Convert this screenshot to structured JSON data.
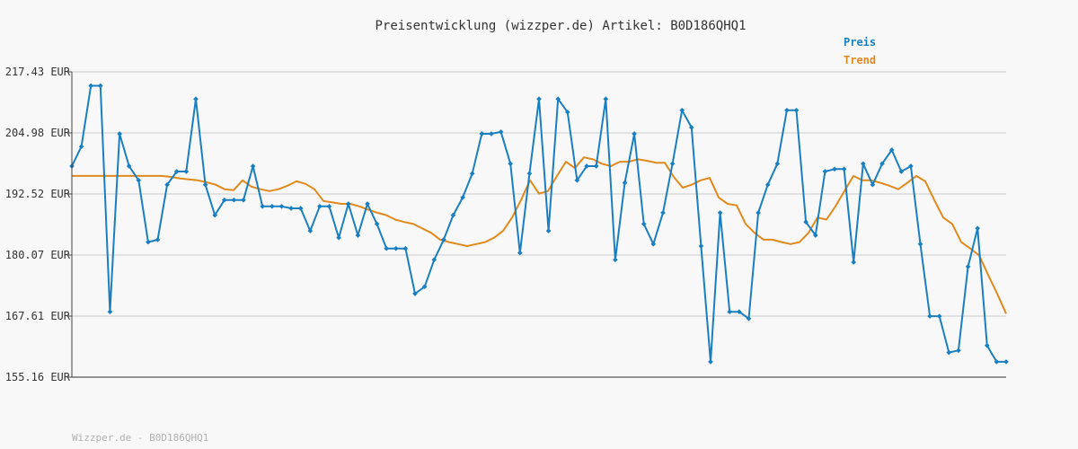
{
  "title": "Preisentwicklung (wizzper.de) Artikel: B0D186QHQ1",
  "footer": "Wizzper.de - B0D186QHQ1",
  "colors": {
    "background": "#f8f8f8",
    "grid": "#e2e2e2",
    "axis": "#444444",
    "preis": "#1a7fc0",
    "trend": "#e08a1e"
  },
  "chart_data": {
    "type": "line",
    "title": "Preisentwicklung (wizzper.de) Artikel: B0D186QHQ1",
    "xlabel": "",
    "ylabel": "",
    "ylim": [
      155.16,
      217.43
    ],
    "yticks": [
      "217.43 EUR",
      "204.98 EUR",
      "192.52 EUR",
      "180.07 EUR",
      "167.61 EUR",
      "155.16 EUR"
    ],
    "ytick_values": [
      217.43,
      204.98,
      192.52,
      180.07,
      167.61,
      155.16
    ],
    "grid": true,
    "legend_position": "top-right",
    "series": [
      {
        "name": "Preis",
        "color": "#1a7fc0",
        "values": [
          198.2,
          202.2,
          214.6,
          214.6,
          168.5,
          204.8,
          198.2,
          195.3,
          182.7,
          183.2,
          194.4,
          197.1,
          197.1,
          211.9,
          194.4,
          188.2,
          191.3,
          191.3,
          191.3,
          198.2,
          190.0,
          190.0,
          190.0,
          189.6,
          189.6,
          185.0,
          190.0,
          190.0,
          183.6,
          190.5,
          184.1,
          190.5,
          186.4,
          181.4,
          181.4,
          181.4,
          172.2,
          173.6,
          179.1,
          183.2,
          188.2,
          191.8,
          196.7,
          204.8,
          204.8,
          205.2,
          198.7,
          180.5,
          196.7,
          211.9,
          185.0,
          211.9,
          209.2,
          195.3,
          198.2,
          198.2,
          211.9,
          179.1,
          194.8,
          204.8,
          186.4,
          182.3,
          188.7,
          198.7,
          209.6,
          206.1,
          181.9,
          158.3,
          188.7,
          168.5,
          168.5,
          167.1,
          188.7,
          194.4,
          198.7,
          209.6,
          209.6,
          186.8,
          184.1,
          197.1,
          197.6,
          197.6,
          178.6,
          198.7,
          194.4,
          198.7,
          201.5,
          197.1,
          198.2,
          182.3,
          167.6,
          167.6,
          160.2,
          160.6,
          177.7,
          185.5,
          161.6,
          158.3,
          158.3
        ],
        "points": [
          0,
          1,
          2,
          3,
          4,
          5,
          6,
          7,
          8,
          9,
          10,
          11,
          12,
          13,
          14,
          15,
          16,
          17,
          18,
          19,
          20,
          21,
          22,
          23,
          24,
          25,
          26,
          27,
          28,
          29,
          30,
          31,
          32,
          33,
          34,
          35,
          36,
          37,
          38,
          39,
          40,
          41,
          42,
          43,
          44,
          45,
          46,
          47,
          48,
          49,
          50,
          51,
          52,
          53,
          54,
          55,
          56,
          57,
          58,
          59,
          60,
          61,
          62,
          63,
          64,
          65,
          66,
          67,
          68,
          69,
          70,
          71,
          72,
          73,
          74,
          75,
          76,
          77,
          78,
          79,
          80,
          81,
          82,
          83,
          84,
          85,
          86,
          87,
          88,
          89,
          90,
          91,
          92,
          93,
          94,
          95,
          96,
          97,
          98
        ]
      },
      {
        "name": "Trend",
        "color": "#e08a1e",
        "values": [
          196.2,
          196.2,
          196.2,
          196.2,
          196.2,
          196.2,
          196.2,
          196.2,
          196.2,
          196.2,
          196.2,
          196.0,
          195.7,
          195.5,
          195.3,
          194.9,
          194.4,
          193.5,
          193.3,
          195.3,
          194.0,
          193.5,
          193.1,
          193.5,
          194.2,
          195.1,
          194.6,
          193.5,
          191.1,
          190.8,
          190.5,
          190.5,
          190.0,
          189.3,
          188.7,
          188.2,
          187.3,
          186.8,
          186.4,
          185.5,
          184.6,
          183.2,
          182.7,
          182.3,
          181.9,
          182.3,
          182.7,
          183.6,
          185.0,
          187.7,
          191.3,
          195.3,
          192.6,
          193.1,
          196.2,
          199.1,
          197.8,
          200.0,
          199.6,
          198.7,
          198.2,
          199.1,
          199.1,
          199.6,
          199.3,
          198.9,
          198.9,
          196.0,
          193.8,
          194.4,
          195.3,
          195.8,
          191.8,
          190.5,
          190.2,
          186.4,
          184.6,
          183.2,
          183.2,
          182.7,
          182.3,
          182.7,
          184.6,
          187.7,
          187.3,
          190.0,
          193.1,
          196.2,
          195.3,
          195.3,
          194.8,
          194.2,
          193.5,
          194.8,
          196.2,
          195.1,
          191.3,
          187.7,
          186.4,
          182.7,
          181.4,
          180.0,
          176.0,
          172.2,
          168.1
        ],
        "points": []
      }
    ]
  }
}
